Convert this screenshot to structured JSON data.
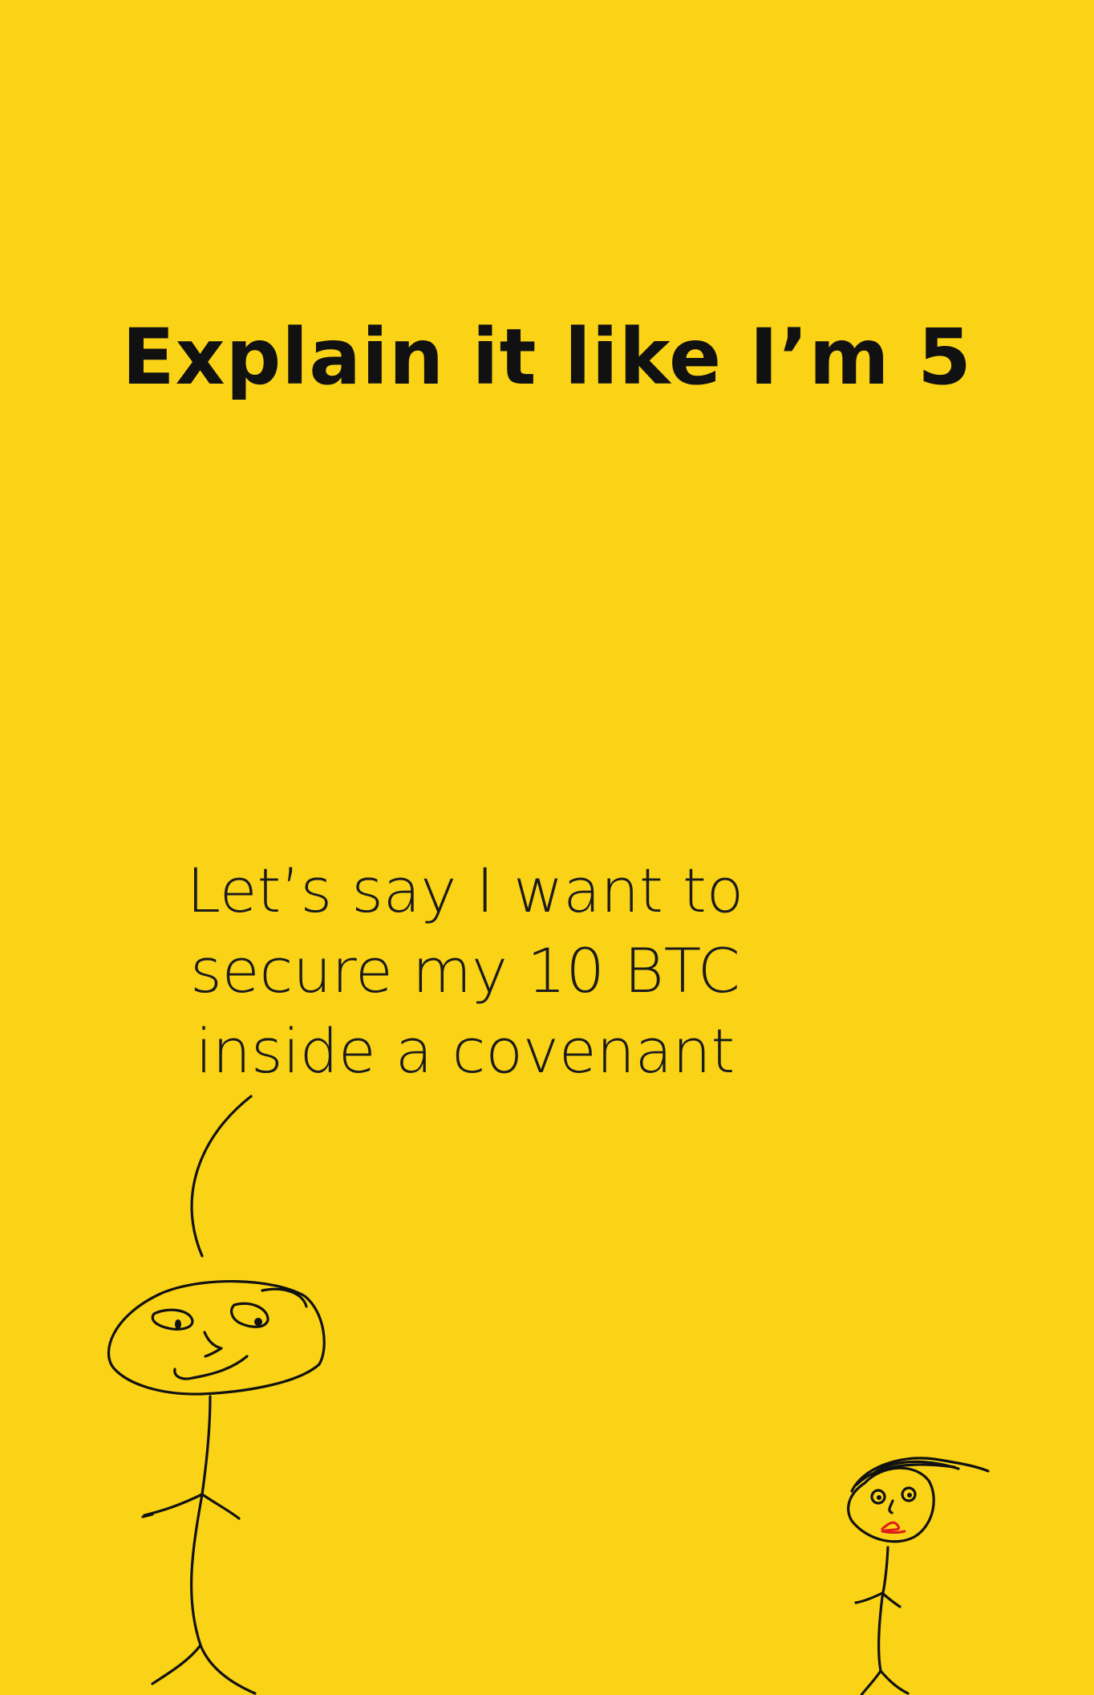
{
  "title": "Explain it like I’m 5",
  "speech": {
    "lines": [
      "Let’s say I want to",
      "secure my 10 BTC",
      "inside a covenant"
    ]
  },
  "illustration": {
    "adult_figure": "stick-figure-adult",
    "child_figure": "stick-figure-child"
  },
  "colors": {
    "background": "#fad316",
    "ink": "#111111",
    "child_mouth": "#e01b1b"
  }
}
